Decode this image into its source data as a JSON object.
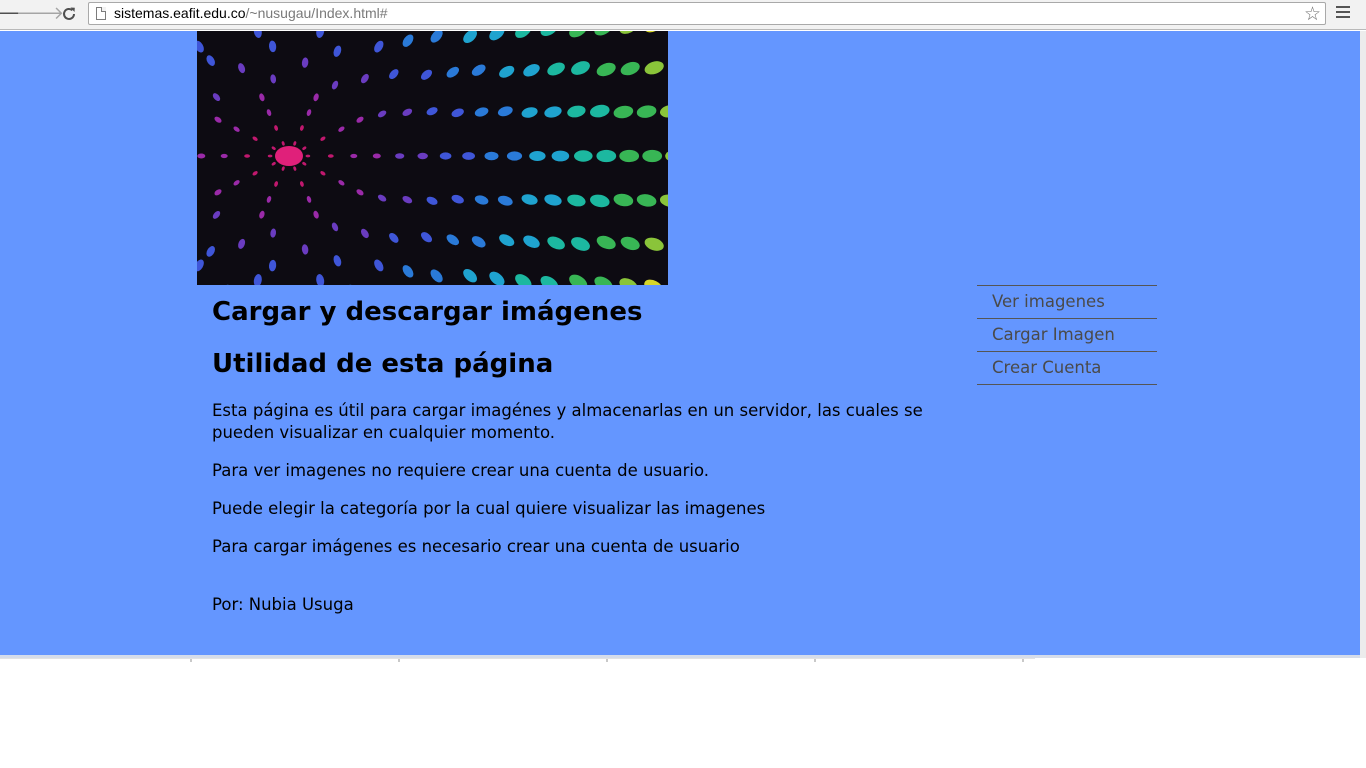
{
  "browser": {
    "url_host": "sistemas.eafit.edu.co",
    "url_path": "/~nusugau/Index.html#",
    "icons": {
      "back": "back-arrow-icon",
      "forward": "forward-arrow-icon",
      "reload": "reload-icon",
      "page": "page-icon",
      "bookmark": "star-icon",
      "menu": "menu-icon"
    }
  },
  "page": {
    "background_color": "#6496ff",
    "banner": {
      "description_icon": "dot-spiral-banner-image"
    },
    "title": "Cargar y descargar imágenes",
    "subtitle": "Utilidad de esta página",
    "paragraphs": [
      "Esta página es útil para cargar imagénes y almacenarlas en un servidor, las cuales se pueden visualizar en cualquier momento.",
      "Para ver imagenes no requiere crear una cuenta de usuario.",
      "Puede elegir la categoría por la cual quiere visualizar las imagenes",
      "Para cargar imágenes es necesario crear una cuenta de usuario"
    ],
    "author": "Por: Nubia Usuga"
  },
  "menu": {
    "items": [
      {
        "label": "Ver imagenes"
      },
      {
        "label": "Cargar Imagen"
      },
      {
        "label": "Crear Cuenta"
      }
    ]
  }
}
